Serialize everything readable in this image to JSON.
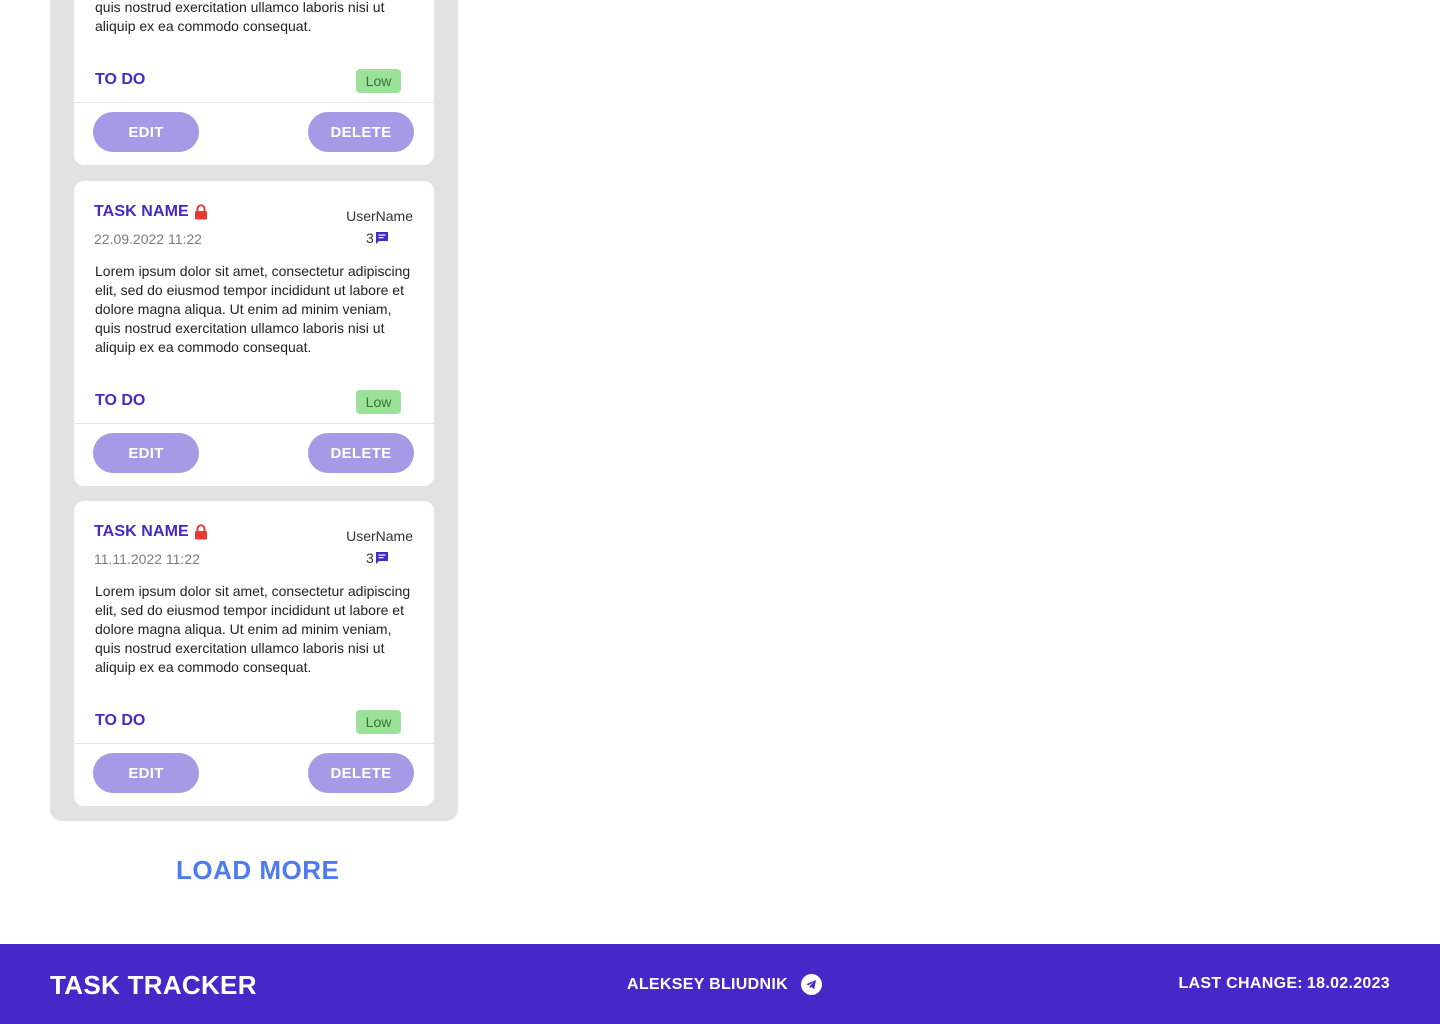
{
  "cards": [
    {
      "title": "",
      "date": "",
      "user": "",
      "comments": "",
      "description": "Lorem ipsum dolor sit amet, consectetur adipiscing elit, sed do eiusmod tempor incididunt ut labore et dolore magna aliqua. Ut enim ad minim veniam, quis nostrud exercitation ullamco laboris nisi ut aliquip ex ea commodo consequat.",
      "status": "TO DO",
      "priority": "Low",
      "edit_label": "EDIT",
      "delete_label": "DELETE"
    },
    {
      "title": "TASK NAME",
      "date": "22.09.2022 11:22",
      "user": "UserName",
      "comments": "3",
      "description": "Lorem ipsum dolor sit amet, consectetur adipiscing elit, sed do eiusmod tempor incididunt ut labore et dolore magna aliqua. Ut enim ad minim veniam, quis nostrud exercitation ullamco laboris nisi ut aliquip ex ea commodo consequat.",
      "status": "TO DO",
      "priority": "Low",
      "edit_label": "EDIT",
      "delete_label": "DELETE"
    },
    {
      "title": "TASK NAME",
      "date": "11.11.2022 11:22",
      "user": "UserName",
      "comments": "3",
      "description": "Lorem ipsum dolor sit amet, consectetur adipiscing elit, sed do eiusmod tempor incididunt ut labore et dolore magna aliqua. Ut enim ad minim veniam, quis nostrud exercitation ullamco laboris nisi ut aliquip ex ea commodo consequat.",
      "status": "TO DO",
      "priority": "Low",
      "edit_label": "EDIT",
      "delete_label": "DELETE"
    }
  ],
  "load_more_label": "LOAD MORE",
  "footer": {
    "brand": "TASK TRACKER",
    "author": "ALEKSEY BLIUDNIK",
    "last_change_label": "LAST CHANGE:",
    "last_change_date": "18.02.2023"
  },
  "icons": {
    "lock": "lock-icon",
    "comment": "comment-icon",
    "telegram": "telegram-icon"
  },
  "colors": {
    "accent": "#4827c9",
    "button": "#a699e6",
    "priority_low_bg": "#9be19a",
    "priority_low_text": "#2c7a2b",
    "lock": "#e53935",
    "link": "#4e7bf2",
    "column_bg": "#e2e2e2"
  }
}
